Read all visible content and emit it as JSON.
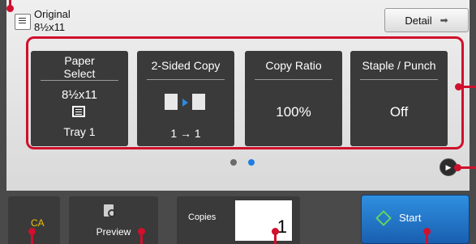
{
  "original": {
    "title": "Original",
    "size": "8½x11"
  },
  "detail": {
    "label": "Detail",
    "arrow": "➡"
  },
  "keys": [
    {
      "title": "Paper Select",
      "value": "8½x11",
      "sub": "Tray 1",
      "icon": "tray-icon"
    },
    {
      "title": "2-Sided Copy",
      "value": "1 → 1",
      "icon": "duplex-icon"
    },
    {
      "title": "Copy Ratio",
      "value": "100%"
    },
    {
      "title": "Staple / Punch",
      "value": "Off"
    }
  ],
  "pager": {
    "active": 1,
    "count": 2,
    "colors": {
      "inactive": "#6a6a6a",
      "active": "#1e7fe0"
    }
  },
  "bottom": {
    "ca": "CA",
    "preview": "Preview",
    "copies_label": "Copies",
    "copies_value": "1",
    "start": "Start"
  },
  "colors": {
    "callout": "#d0102c",
    "start": "#2f8fe0"
  }
}
